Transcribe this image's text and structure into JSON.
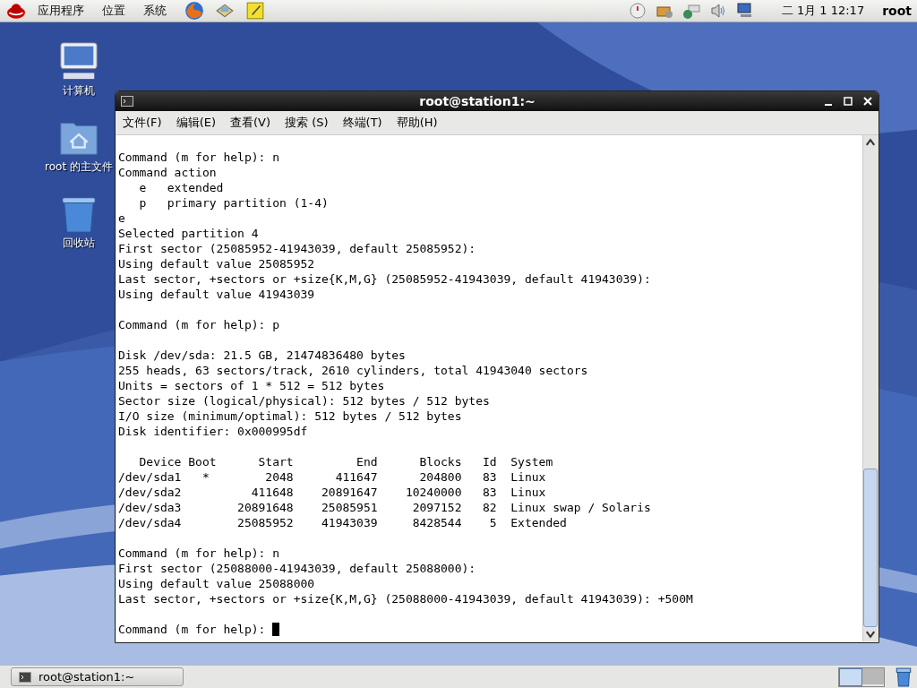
{
  "top_panel": {
    "menus": [
      "应用程序",
      "位置",
      "系统"
    ],
    "clock": "二  1月  1 12:17",
    "user": "root"
  },
  "desktop_icons": [
    {
      "kind": "computer",
      "label": "计算机"
    },
    {
      "kind": "home",
      "label": "root 的主文件"
    },
    {
      "kind": "trash",
      "label": "回收站"
    }
  ],
  "window": {
    "title": "root@station1:~",
    "menu": [
      "文件(F)",
      "编辑(E)",
      "查看(V)",
      "搜索 (S)",
      "终端(T)",
      "帮助(H)"
    ],
    "terminal_blocks": [
      [
        "Command (m for help): n",
        "Command action",
        "   e   extended",
        "   p   primary partition (1-4)",
        "e",
        "Selected partition 4",
        "First sector (25085952-41943039, default 25085952):",
        "Using default value 25085952",
        "Last sector, +sectors or +size{K,M,G} (25085952-41943039, default 41943039):",
        "Using default value 41943039"
      ],
      [
        "Command (m for help): p"
      ],
      [
        "Disk /dev/sda: 21.5 GB, 21474836480 bytes",
        "255 heads, 63 sectors/track, 2610 cylinders, total 41943040 sectors",
        "Units = sectors of 1 * 512 = 512 bytes",
        "Sector size (logical/physical): 512 bytes / 512 bytes",
        "I/O size (minimum/optimal): 512 bytes / 512 bytes",
        "Disk identifier: 0x000995df"
      ],
      [
        "   Device Boot      Start         End      Blocks   Id  System",
        "/dev/sda1   *        2048      411647      204800   83  Linux",
        "/dev/sda2          411648    20891647    10240000   83  Linux",
        "/dev/sda3        20891648    25085951     2097152   82  Linux swap / Solaris",
        "/dev/sda4        25085952    41943039     8428544    5  Extended"
      ],
      [
        "Command (m for help): n",
        "First sector (25088000-41943039, default 25088000):",
        "Using default value 25088000",
        "Last sector, +sectors or +size{K,M,G} (25088000-41943039, default 41943039): +500M"
      ]
    ],
    "prompt": "Command (m for help): "
  },
  "taskbar": {
    "tasks": [
      {
        "label": "root@station1:~",
        "selected": false
      }
    ],
    "workspaces": [
      {
        "selected": true
      },
      {
        "selected": false
      }
    ]
  }
}
